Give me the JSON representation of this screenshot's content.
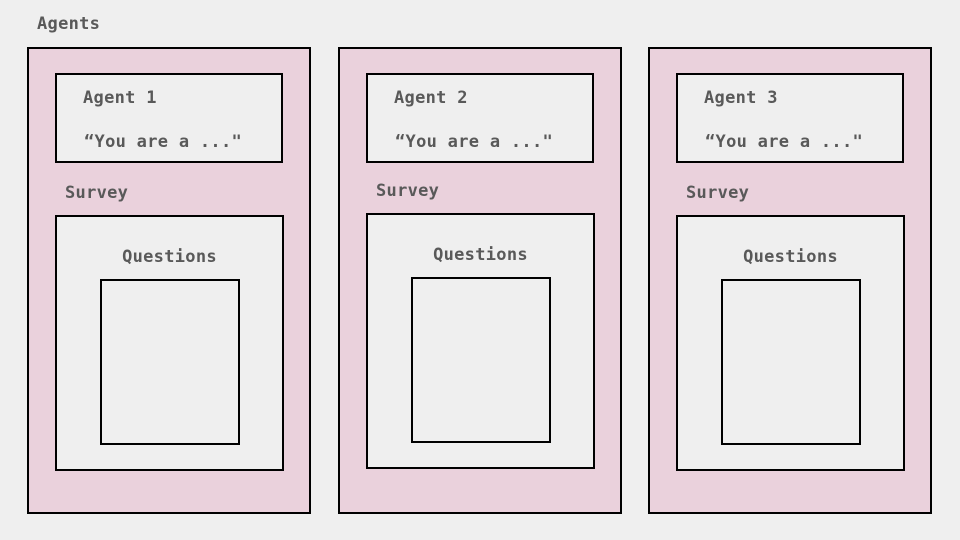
{
  "diagram": {
    "title": "Agents",
    "survey_label": "Survey",
    "questions_label": "Questions",
    "agents": [
      {
        "name": "Agent 1",
        "prompt": "“You are a ...\""
      },
      {
        "name": "Agent 2",
        "prompt": "“You are a ...\""
      },
      {
        "name": "Agent 3",
        "prompt": "“You are a ...\""
      }
    ]
  },
  "colors": {
    "background": "#efefef",
    "agent_column_fill": "#ead1dc",
    "border": "#000000",
    "text": "#595959"
  }
}
